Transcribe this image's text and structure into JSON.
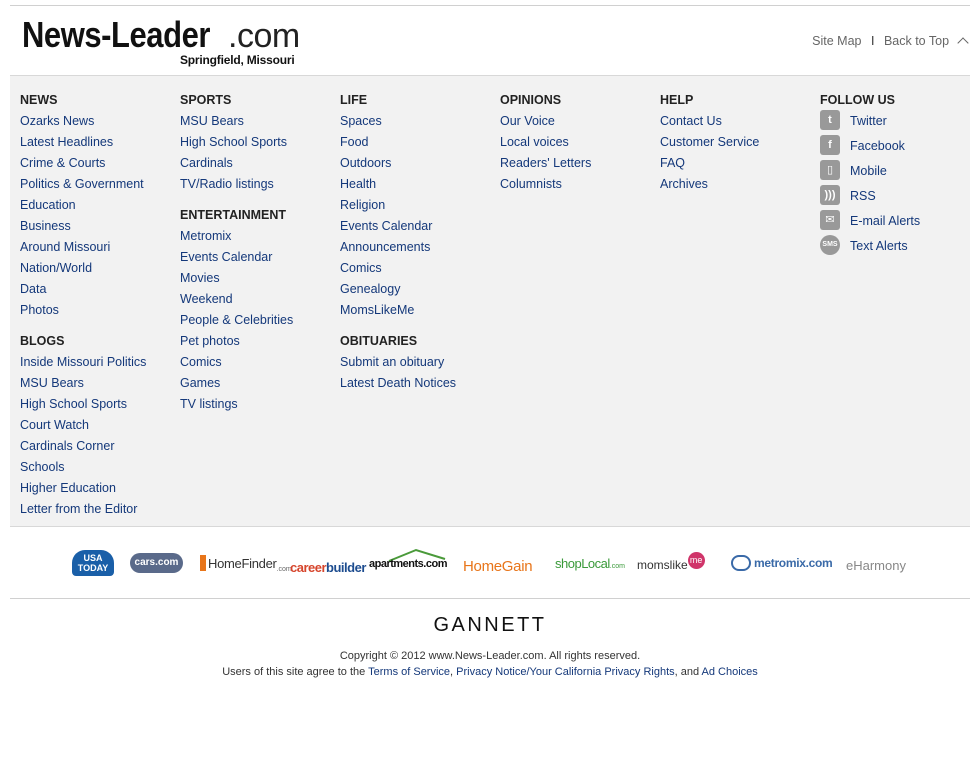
{
  "header": {
    "logo_main": "News-Leader",
    "logo_domain": ".com",
    "logo_sub": "Springfield, Missouri",
    "site_map": "Site Map",
    "separator": "I",
    "back_to_top": "Back to Top"
  },
  "columns": {
    "news": {
      "title": "NEWS",
      "items": [
        "Ozarks News",
        "Latest Headlines",
        "Crime & Courts",
        "Politics & Government",
        "Education",
        "Business",
        "Around Missouri",
        "Nation/World",
        "Data",
        "Photos"
      ]
    },
    "blogs": {
      "title": "BLOGS",
      "items": [
        "Inside Missouri Politics",
        "MSU Bears",
        "High School Sports",
        "Court Watch",
        "Cardinals Corner",
        "Schools",
        "Higher Education",
        "Letter from the Editor"
      ]
    },
    "sports": {
      "title": "SPORTS",
      "items": [
        "MSU Bears",
        "High School Sports",
        "Cardinals",
        "TV/Radio listings"
      ]
    },
    "entertainment": {
      "title": "ENTERTAINMENT",
      "items": [
        "Metromix",
        "Events Calendar",
        "Movies",
        "Weekend",
        "People & Celebrities",
        "Pet photos",
        "Comics",
        "Games",
        "TV listings"
      ]
    },
    "life": {
      "title": "LIFE",
      "items": [
        "Spaces",
        "Food",
        "Outdoors",
        "Health",
        "Religion",
        "Events Calendar",
        "Announcements",
        "Comics",
        "Genealogy",
        "MomsLikeMe"
      ]
    },
    "obituaries": {
      "title": "OBITUARIES",
      "items": [
        "Submit an obituary",
        "Latest Death Notices"
      ]
    },
    "opinions": {
      "title": "OPINIONS",
      "items": [
        "Our Voice",
        "Local voices",
        "Readers' Letters",
        "Columnists"
      ]
    },
    "help": {
      "title": "HELP",
      "items": [
        "Contact Us",
        "Customer Service",
        "FAQ",
        "Archives"
      ]
    },
    "follow": {
      "title": "FOLLOW US",
      "items": [
        {
          "label": "Twitter",
          "icon": "twitter-icon",
          "glyph": "t"
        },
        {
          "label": "Facebook",
          "icon": "facebook-icon",
          "glyph": "f"
        },
        {
          "label": "Mobile",
          "icon": "mobile-icon",
          "glyph": "▯"
        },
        {
          "label": "RSS",
          "icon": "rss-icon",
          "glyph": ")))"
        },
        {
          "label": "E-mail Alerts",
          "icon": "email-icon",
          "glyph": "✉"
        },
        {
          "label": "Text Alerts",
          "icon": "sms-icon",
          "glyph": "SMS"
        }
      ]
    }
  },
  "partners": {
    "usatoday": "USA TODAY",
    "cars": "cars.com",
    "homefinder": "HomeFinder",
    "homefinder_sub": ".com",
    "careerbuilder_a": "career",
    "careerbuilder_b": "builder",
    "apartments": "apartments.com",
    "homegain": "HomeGain",
    "shoplocal": "shopLocal",
    "shoplocal_sub": ".com",
    "momslikeme_a": "momslike",
    "momslikeme_b": "me",
    "metromix": "metromix.com",
    "eharmony": "eHarmony"
  },
  "footer": {
    "gannett": "GANNETT",
    "copyright": "Copyright © 2012 www.News-Leader.com. All rights reserved.",
    "agree_prefix": "Users of this site agree to the ",
    "terms": "Terms of Service",
    "comma": ", ",
    "privacy": "Privacy Notice/Your California Privacy Rights",
    "and": ", and ",
    "adchoices": "Ad Choices"
  },
  "colors": {
    "link": "#14387a",
    "panel_bg": "#f2f2f2",
    "icon_gray": "#999999"
  }
}
